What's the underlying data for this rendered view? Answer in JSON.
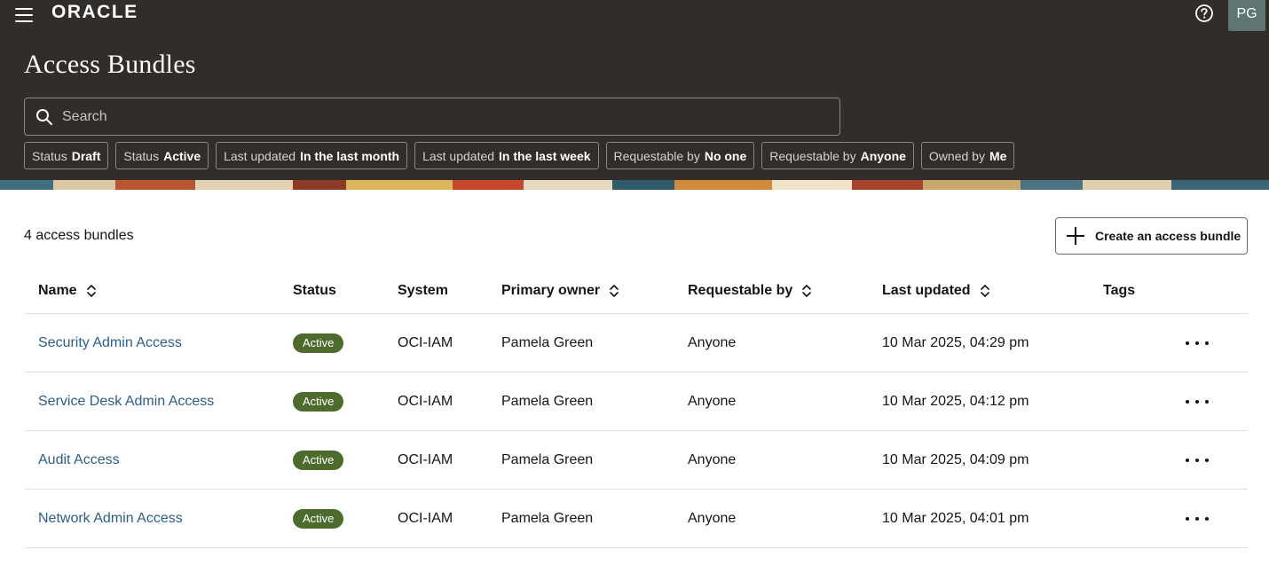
{
  "header": {
    "logo_text": "ORACLE",
    "avatar_initials": "PG",
    "page_title": "Access Bundles"
  },
  "search": {
    "placeholder": "Search",
    "value": ""
  },
  "filters": [
    {
      "label": "Status",
      "value": "Draft"
    },
    {
      "label": "Status",
      "value": "Active"
    },
    {
      "label": "Last updated",
      "value": "In the last month"
    },
    {
      "label": "Last updated",
      "value": "In the last week"
    },
    {
      "label": "Requestable by",
      "value": "No one"
    },
    {
      "label": "Requestable by",
      "value": "Anyone"
    },
    {
      "label": "Owned by",
      "value": "Me"
    }
  ],
  "summary": {
    "count_text": "4 access bundles"
  },
  "actions": {
    "create_label": "Create an access bundle"
  },
  "table": {
    "columns": [
      "Name",
      "Status",
      "System",
      "Primary owner",
      "Requestable by",
      "Last updated",
      "Tags"
    ],
    "rows": [
      {
        "name": "Security Admin Access",
        "status": "Active",
        "system": "OCI-IAM",
        "owner": "Pamela Green",
        "requestable_by": "Anyone",
        "last_updated": "10 Mar 2025, 04:29 pm"
      },
      {
        "name": "Service Desk Admin Access",
        "status": "Active",
        "system": "OCI-IAM",
        "owner": "Pamela Green",
        "requestable_by": "Anyone",
        "last_updated": "10 Mar 2025, 04:12 pm"
      },
      {
        "name": "Audit Access",
        "status": "Active",
        "system": "OCI-IAM",
        "owner": "Pamela Green",
        "requestable_by": "Anyone",
        "last_updated": "10 Mar 2025, 04:09 pm"
      },
      {
        "name": "Network Admin Access",
        "status": "Active",
        "system": "OCI-IAM",
        "owner": "Pamela Green",
        "requestable_by": "Anyone",
        "last_updated": "10 Mar 2025, 04:01 pm"
      }
    ]
  },
  "colors": {
    "header_bg": "#312d2a",
    "link": "#2a5f8a",
    "active_badge": "#4e6b2e",
    "avatar_bg": "#5d7672"
  },
  "icons": {
    "menu": "hamburger-icon",
    "help": "help-icon",
    "search": "search-icon",
    "add": "plus-icon",
    "sort": "sort-icon",
    "row_actions": "more-icon"
  }
}
